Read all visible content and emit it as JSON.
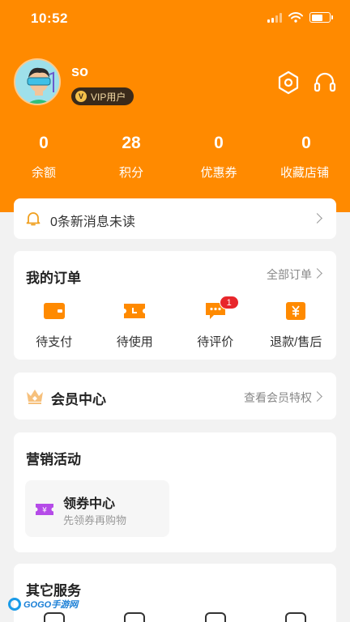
{
  "status_bar": {
    "time": "10:52"
  },
  "profile": {
    "username": "so",
    "vip_label": "VIP用户",
    "vip_icon": "v-badge-icon"
  },
  "header_icons": {
    "settings": "hexagon-settings-icon",
    "service": "headset-icon"
  },
  "stats": [
    {
      "value": "0",
      "label": "余额"
    },
    {
      "value": "28",
      "label": "积分"
    },
    {
      "value": "0",
      "label": "优惠券"
    },
    {
      "value": "0",
      "label": "收藏店铺"
    }
  ],
  "messages": {
    "text": "0条新消息未读"
  },
  "orders": {
    "title": "我的订单",
    "all_link": "全部订单",
    "items": [
      {
        "label": "待支付",
        "icon": "wallet-icon",
        "badge": ""
      },
      {
        "label": "待使用",
        "icon": "ticket-icon",
        "badge": ""
      },
      {
        "label": "待评价",
        "icon": "comment-icon",
        "badge": "1"
      },
      {
        "label": "退款/售后",
        "icon": "yen-refund-icon",
        "badge": ""
      }
    ]
  },
  "member": {
    "title": "会员中心",
    "link": "查看会员特权"
  },
  "marketing": {
    "title": "营销活动",
    "coupon": {
      "title": "领券中心",
      "subtitle": "先领券再购物"
    }
  },
  "other_services": {
    "title": "其它服务"
  },
  "watermark": {
    "text": "GOGO手游网"
  },
  "colors": {
    "brand": "#ff8a00",
    "badge": "#e8262b",
    "vip_bg": "#3a2a1a",
    "coupon_icon": "#b54be8"
  }
}
